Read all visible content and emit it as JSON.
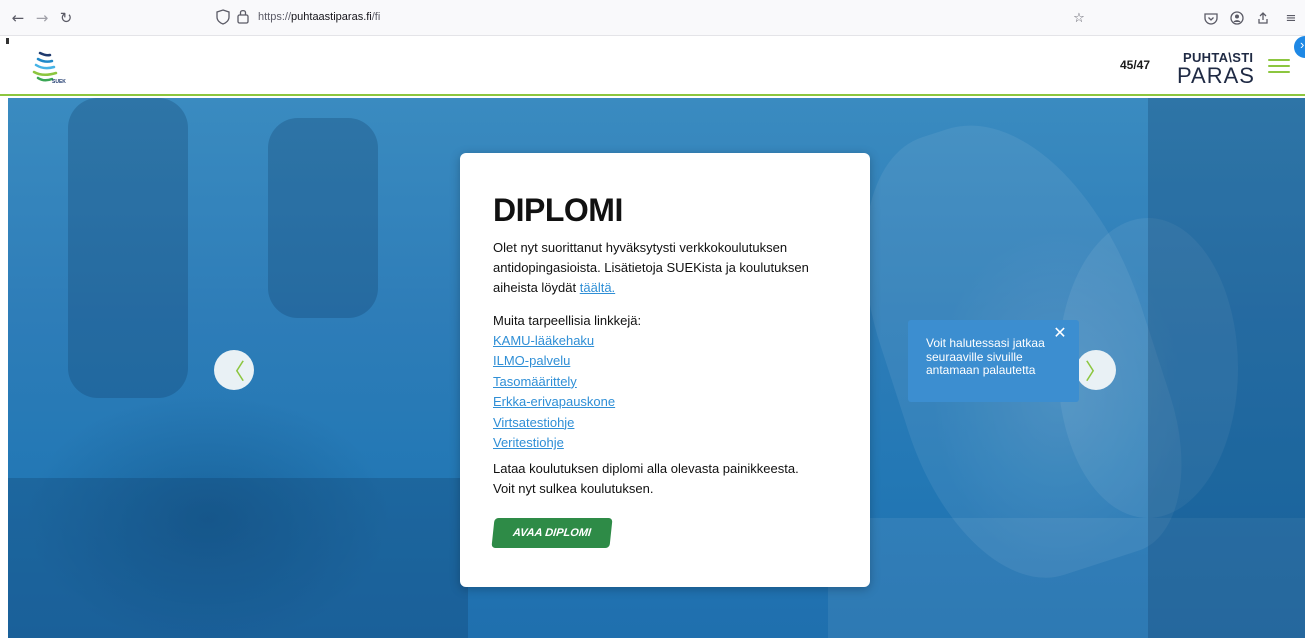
{
  "browser": {
    "url_prefix": "https://",
    "url_domain": "puhtaastiparas.fi",
    "url_path": "/fi",
    "icons": [
      "back-icon",
      "forward-icon",
      "reload-icon",
      "shield-icon",
      "lock-icon",
      "bookmark-star-icon",
      "pocket-icon",
      "account-icon",
      "share-icon",
      "menu-icon"
    ]
  },
  "header": {
    "logo_label": "SUEK",
    "progress": "45/47",
    "brand_top": "PUHTA\\STI",
    "brand_bottom": "PARAS",
    "accent_color": "#8cc63f"
  },
  "card": {
    "title": "DIPLOMI",
    "intro_text": "Olet nyt suorittanut hyväksytysti verkkokoulutuksen antidopingasioista. Lisätietoja SUEKista ja koulutuksen aiheista löydät",
    "intro_link": "täältä.",
    "links_heading": "Muita tarpeellisia linkkejä:",
    "links": [
      "KAMU-lääkehaku",
      "ILMO-palvelu",
      "Tasomäärittely",
      "Erkka-erivapauskone",
      "Virtsatestiohje",
      "Veritestiohje"
    ],
    "outro_line1": "Lataa koulutuksen diplomi alla olevasta painikkeesta.",
    "outro_line2": "Voit nyt sulkea koulutuksen.",
    "button_label": "AVAA DIPLOMI",
    "button_color": "#2e8b47",
    "link_color": "#2f8fd6"
  },
  "carousel": {
    "prev_glyph": "〈",
    "next_glyph": "〉"
  },
  "tooltip": {
    "text": "Voit halutessasi jatkaa seuraaville sivuille antamaan palautetta",
    "close_glyph": "✕",
    "color": "#3c8ed0"
  }
}
